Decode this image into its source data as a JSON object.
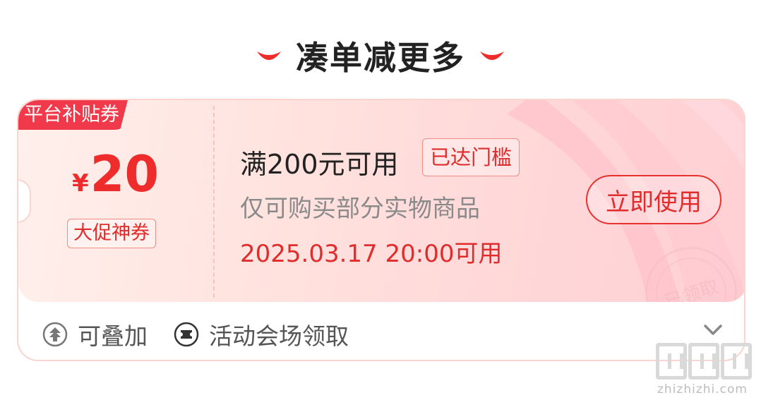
{
  "header": {
    "title": "凑单减更多"
  },
  "coupon": {
    "corner_tag": "平台补贴券",
    "currency": "¥",
    "amount": "20",
    "promo_badge": "大促神券",
    "condition": "满200元可用",
    "threshold_badge": "已达门槛",
    "scope": "仅可购买部分实物商品",
    "available_time": "2025.03.17 20:00可用",
    "use_button": "立即使用",
    "stamp_text": "已领取"
  },
  "footer": {
    "stackable": "可叠加",
    "source": "活动会场领取"
  },
  "watermark": {
    "site": "zhizhizhi.com"
  },
  "colors": {
    "accent": "#e12c2c",
    "tag_bg": "#f0394a",
    "card_border": "#fbd3cf"
  }
}
